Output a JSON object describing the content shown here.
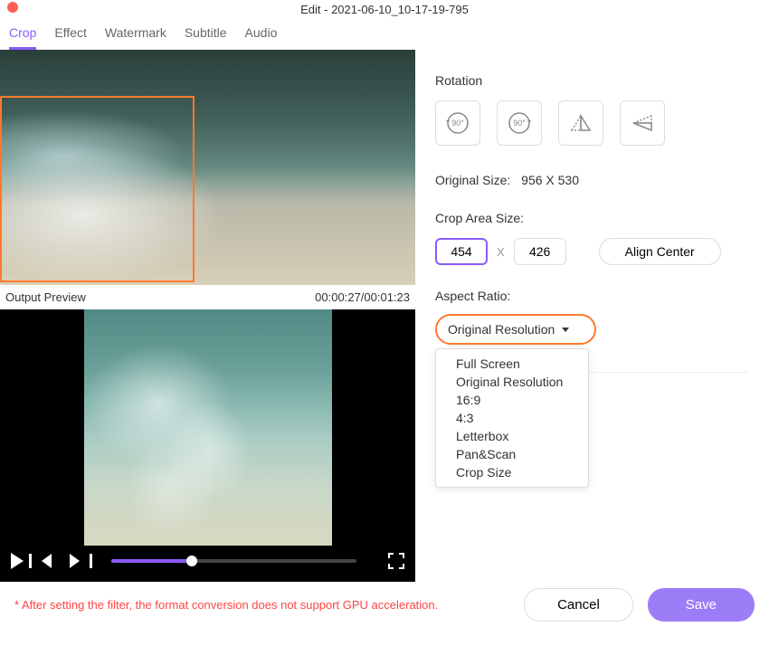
{
  "window": {
    "title": "Edit - 2021-06-10_10-17-19-795"
  },
  "tabs": {
    "items": [
      "Crop",
      "Effect",
      "Watermark",
      "Subtitle",
      "Audio"
    ],
    "active": "Crop"
  },
  "preview": {
    "output_label": "Output Preview",
    "timecode": "00:00:27/00:01:23"
  },
  "rotation": {
    "label": "Rotation",
    "btn_ccw": "90°",
    "btn_cw": "90°"
  },
  "original_size": {
    "label": "Original Size:",
    "value": "956 X 530"
  },
  "crop_area": {
    "label": "Crop Area Size:",
    "width": "454",
    "height": "426",
    "separator": "X",
    "align_center": "Align Center"
  },
  "aspect": {
    "label": "Aspect Ratio:",
    "selected": "Original Resolution",
    "options": [
      "Full Screen",
      "Original Resolution",
      "16:9",
      "4:3",
      "Letterbox",
      "Pan&Scan",
      "Crop Size"
    ]
  },
  "footer": {
    "note": "* After setting the filter, the format conversion does not support GPU acceleration.",
    "cancel": "Cancel",
    "save": "Save"
  }
}
